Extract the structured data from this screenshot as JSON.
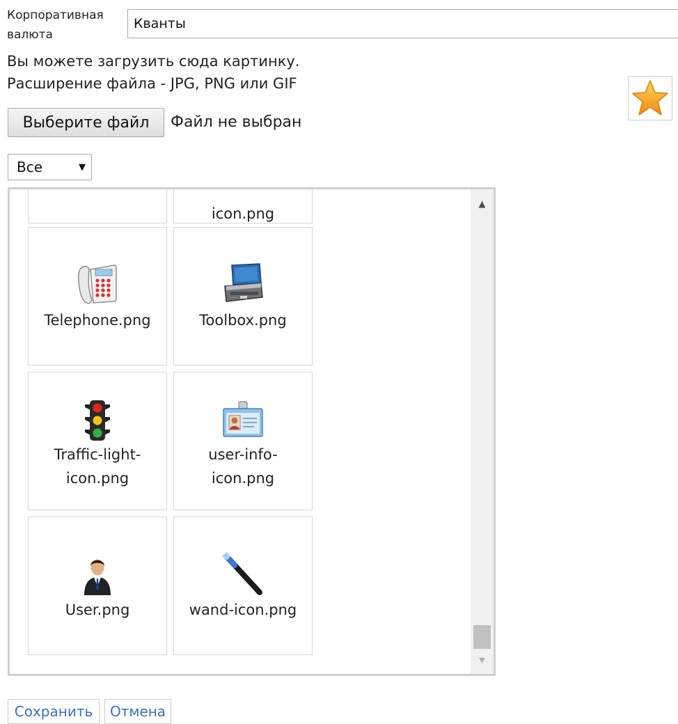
{
  "form": {
    "currency_label": "Корпоративная валюта",
    "currency_value": "Кванты",
    "hint_line1": "Вы можете загрузить сюда картинку.",
    "hint_line2": "Расширение файла - JPG, PNG или GIF",
    "file_button": "Выберите файл",
    "file_status": "Файл не выбран",
    "filter_selected": "Все"
  },
  "preview": {
    "icon": "star-icon"
  },
  "gallery": {
    "items": [
      {
        "name": "",
        "icon": "cut-off-icon"
      },
      {
        "name": "icon.png",
        "icon": "cut-off-icon"
      },
      {
        "name": "Telephone.png",
        "icon": "telephone-icon"
      },
      {
        "name": "Toolbox.png",
        "icon": "toolbox-icon"
      },
      {
        "name": "Traffic-light-icon.png",
        "line1": "Traffic-light-",
        "line2": "icon.png",
        "icon": "traffic-light-icon"
      },
      {
        "name": "user-info-icon.png",
        "line1": "user-info-",
        "line2": "icon.png",
        "icon": "user-info-icon"
      },
      {
        "name": "User.png",
        "icon": "user-icon"
      },
      {
        "name": "wand-icon.png",
        "icon": "wand-icon"
      }
    ]
  },
  "actions": {
    "save": "Сохранить",
    "cancel": "Отмена"
  },
  "colors": {
    "link": "#3a6fc4",
    "border": "#cfcfcf",
    "scrollbar": "#f1f1f1",
    "thumb": "#c1c1c1"
  }
}
